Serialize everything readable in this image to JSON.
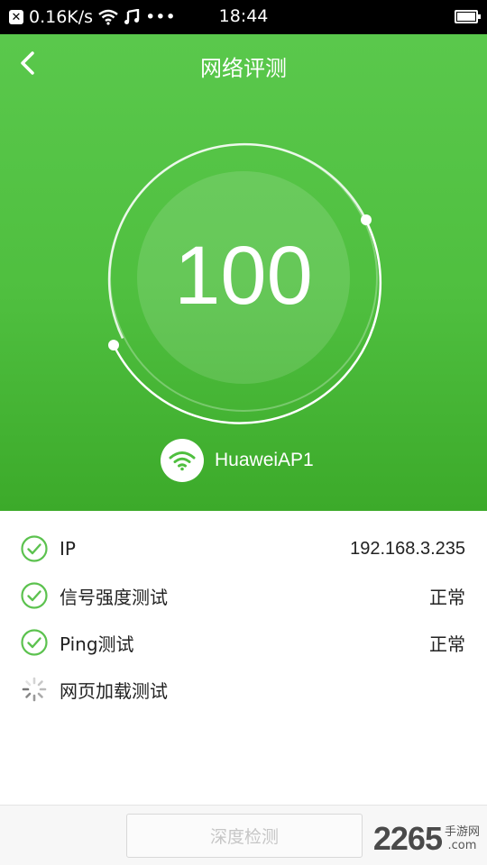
{
  "status_bar": {
    "network_speed": "0.16K/s",
    "extra": "•••",
    "time": "18:44"
  },
  "header": {
    "title": "网络评测"
  },
  "score": {
    "value": "100"
  },
  "network": {
    "ssid": "HuaweiAP1"
  },
  "results": [
    {
      "label": "IP",
      "value": "192.168.3.235",
      "status": "done"
    },
    {
      "label": "信号强度测试",
      "value": "正常",
      "status": "done"
    },
    {
      "label": "Ping测试",
      "value": "正常",
      "status": "done"
    },
    {
      "label": "网页加载测试",
      "value": "",
      "status": "loading"
    }
  ],
  "footer": {
    "deep_test_label": "深度检测",
    "watermark_number": "2265",
    "watermark_text": "手游网",
    "watermark_domain": ".com"
  },
  "colors": {
    "accent_green": "#4fbf3f",
    "check_green": "#5cc24f"
  }
}
